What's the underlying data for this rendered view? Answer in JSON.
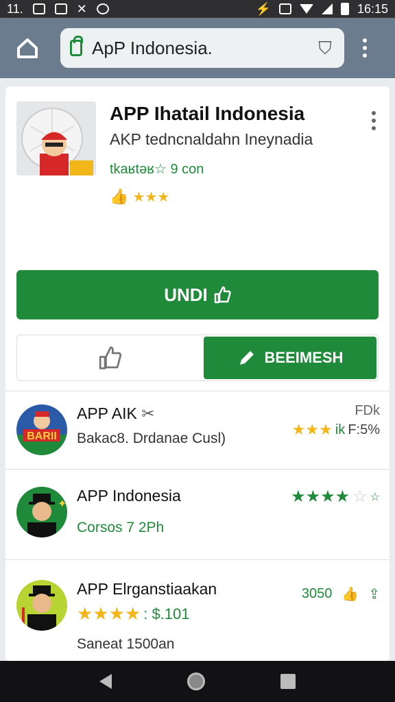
{
  "status_bar": {
    "time_left": "11.",
    "time_right": "16:15"
  },
  "browser": {
    "url": "ApP Indonesia."
  },
  "app": {
    "title": "APP Ihatail Indonesia",
    "subtitle": "AKP tedncnaldahn Ineynadia",
    "tag": "tkaʁtǝʁ☆ 9 con",
    "rating_stars": "★★★"
  },
  "install_button": {
    "label": "UNDI"
  },
  "tabs": {
    "right_label": "BEEIMESH"
  },
  "list": [
    {
      "title": "APP AIK",
      "subtitle": "Bakac8. Drdanae Cusl)",
      "right_top": "FDk",
      "right_bottom": "F:5%",
      "avatar_text": "BARII"
    },
    {
      "title": "APP Indonesia",
      "subtitle": "Corsos 7 2Ph",
      "right_top": ""
    },
    {
      "title": "APP Elrganstiaakan",
      "subtitle": "Saneat 1500an",
      "stars_value": ": $.101",
      "right_top": "3050"
    }
  ]
}
